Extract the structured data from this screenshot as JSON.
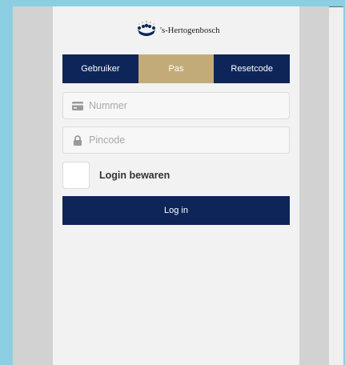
{
  "logo": {
    "icon": "crown-icon",
    "text": "'s-Hertogenbosch"
  },
  "tabs": [
    {
      "label": "Gebruiker",
      "active": false
    },
    {
      "label": "Pas",
      "active": true
    },
    {
      "label": "Resetcode",
      "active": false
    }
  ],
  "form": {
    "number": {
      "placeholder": "Nummer",
      "value": "",
      "icon": "card-icon"
    },
    "pincode": {
      "placeholder": "Pincode",
      "value": "",
      "icon": "lock-icon"
    },
    "remember": {
      "label": "Login bewaren",
      "checked": false
    },
    "submit_label": "Log in"
  },
  "colors": {
    "navy": "#0d2559",
    "gold": "#c3ab79",
    "page_background": "#8ccfe3"
  }
}
